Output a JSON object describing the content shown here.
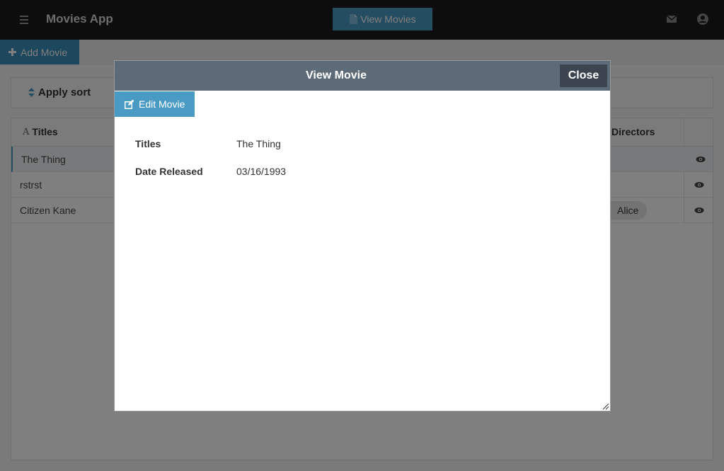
{
  "app": {
    "title": "Movies App",
    "view_movies_label": "View Movies",
    "icons": [
      "hamburger-icon",
      "document-icon",
      "mail-icon",
      "user-icon"
    ]
  },
  "toolbar": {
    "add_movie_label": "Add Movie"
  },
  "sortbar": {
    "apply_sort_label": "Apply sort"
  },
  "table": {
    "columns": [
      "Titles",
      "Directors"
    ],
    "rows": [
      {
        "title": "The Thing",
        "director": ""
      },
      {
        "title": "rstrst",
        "director": ""
      },
      {
        "title": "Citizen Kane",
        "director": "Alice"
      }
    ]
  },
  "modal": {
    "title": "View Movie",
    "close_label": "Close",
    "edit_label": "Edit Movie",
    "fields": [
      {
        "label": "Titles",
        "value": "The Thing"
      },
      {
        "label": "Date Released",
        "value": "03/16/1993"
      }
    ]
  },
  "colors": {
    "topbar": "#1b1b1b",
    "accent": "#4a9bc4",
    "modal_header": "#5d6b79",
    "close_button": "#3c4450"
  }
}
